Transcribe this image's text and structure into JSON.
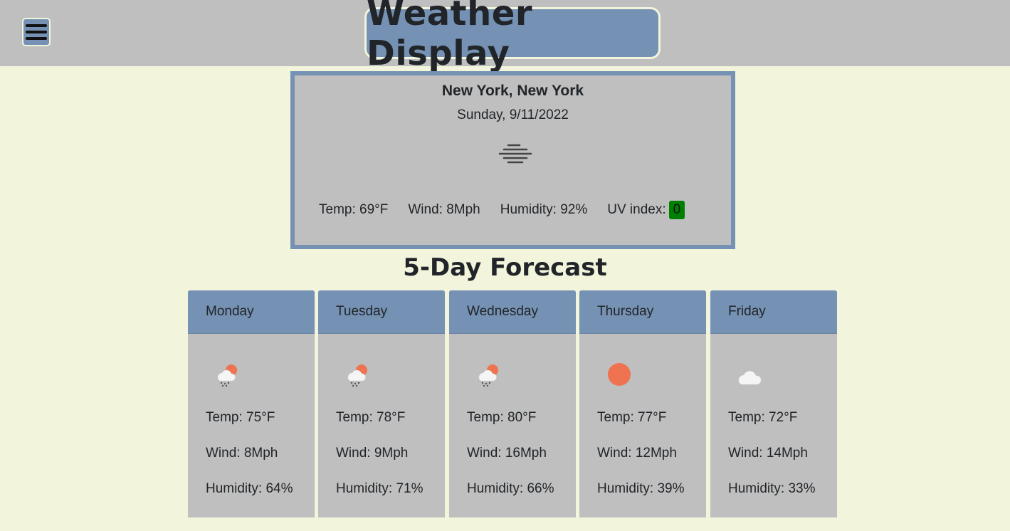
{
  "header": {
    "title": "Weather Display",
    "menu_icon": "hamburger-icon"
  },
  "current": {
    "city": "New York, New York",
    "date": "Sunday, 9/11/2022",
    "icon": "fog-icon",
    "temp": "Temp: 69°F",
    "wind": "Wind: 8Mph",
    "humidity": "Humidity: 92%",
    "uv_label": "UV index:",
    "uv_value": "0",
    "uv_color": "#008000"
  },
  "forecast": {
    "title": "5-Day Forecast",
    "days": [
      {
        "day": "Monday",
        "icon": "rain-sun-icon",
        "temp": "Temp: 75°F",
        "wind": "Wind: 8Mph",
        "humidity": "Humidity: 64%"
      },
      {
        "day": "Tuesday",
        "icon": "rain-sun-icon",
        "temp": "Temp: 78°F",
        "wind": "Wind: 9Mph",
        "humidity": "Humidity: 71%"
      },
      {
        "day": "Wednesday",
        "icon": "rain-sun-icon",
        "temp": "Temp: 80°F",
        "wind": "Wind: 16Mph",
        "humidity": "Humidity: 66%"
      },
      {
        "day": "Thursday",
        "icon": "sun-icon",
        "temp": "Temp: 77°F",
        "wind": "Wind: 12Mph",
        "humidity": "Humidity: 39%"
      },
      {
        "day": "Friday",
        "icon": "cloud-icon",
        "temp": "Temp: 72°F",
        "wind": "Wind: 14Mph",
        "humidity": "Humidity: 33%"
      }
    ]
  },
  "colors": {
    "background": "#f2f5dc",
    "bar": "#bfbfbf",
    "accent": "#7591b3",
    "sun": "#ef7350"
  }
}
